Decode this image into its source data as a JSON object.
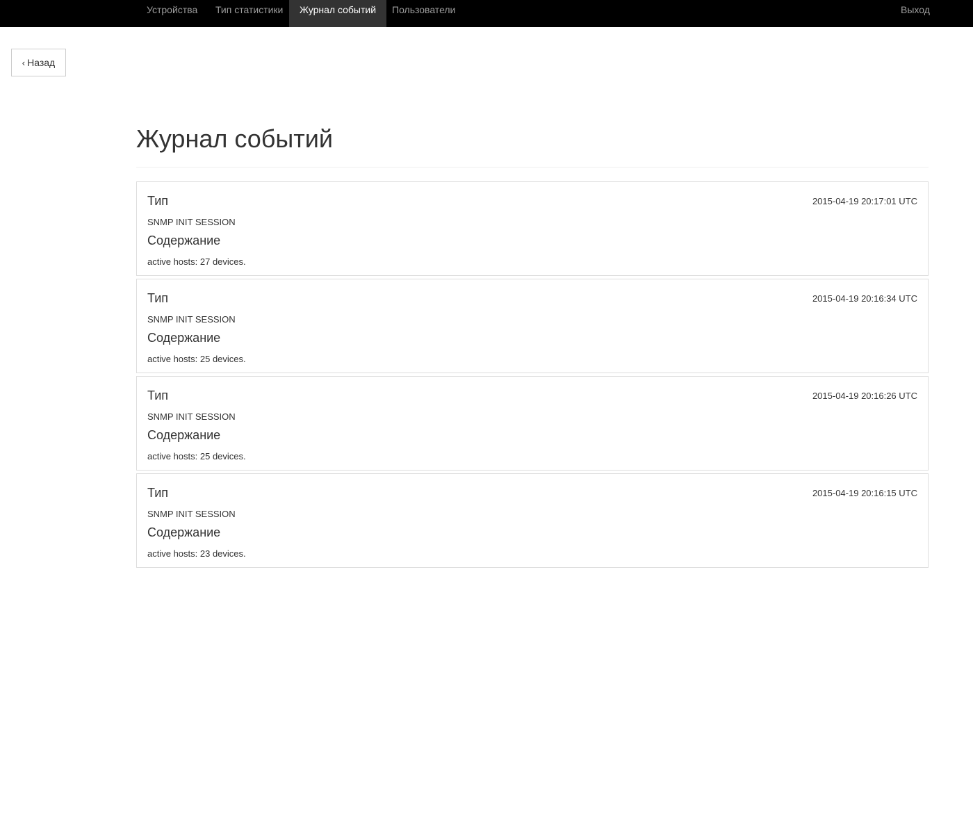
{
  "nav": {
    "items": [
      {
        "label": "Устройства"
      },
      {
        "label": "Тип статистики"
      },
      {
        "label": "Журнал событий"
      },
      {
        "label": "Пользователи"
      }
    ],
    "active_index": 2,
    "logout_label": "Выход"
  },
  "back_button": {
    "chevron": "‹",
    "label": "Назад"
  },
  "page": {
    "title": "Журнал событий"
  },
  "events": [
    {
      "type_label": "Тип",
      "type_value": "SNMP INIT SESSION",
      "content_label": "Содержание",
      "content_value": "active hosts: 27 devices.",
      "timestamp": "2015-04-19 20:17:01 UTC"
    },
    {
      "type_label": "Тип",
      "type_value": "SNMP INIT SESSION",
      "content_label": "Содержание",
      "content_value": "active hosts: 25 devices.",
      "timestamp": "2015-04-19 20:16:34 UTC"
    },
    {
      "type_label": "Тип",
      "type_value": "SNMP INIT SESSION",
      "content_label": "Содержание",
      "content_value": "active hosts: 25 devices.",
      "timestamp": "2015-04-19 20:16:26 UTC"
    },
    {
      "type_label": "Тип",
      "type_value": "SNMP INIT SESSION",
      "content_label": "Содержание",
      "content_value": "active hosts: 23 devices.",
      "timestamp": "2015-04-19 20:16:15 UTC"
    }
  ],
  "colors": {
    "navbar_bg": "#000000",
    "nav_active_bg": "#333333",
    "nav_text": "#9d9d9d",
    "nav_active_text": "#ffffff",
    "card_border": "#dddddd"
  }
}
